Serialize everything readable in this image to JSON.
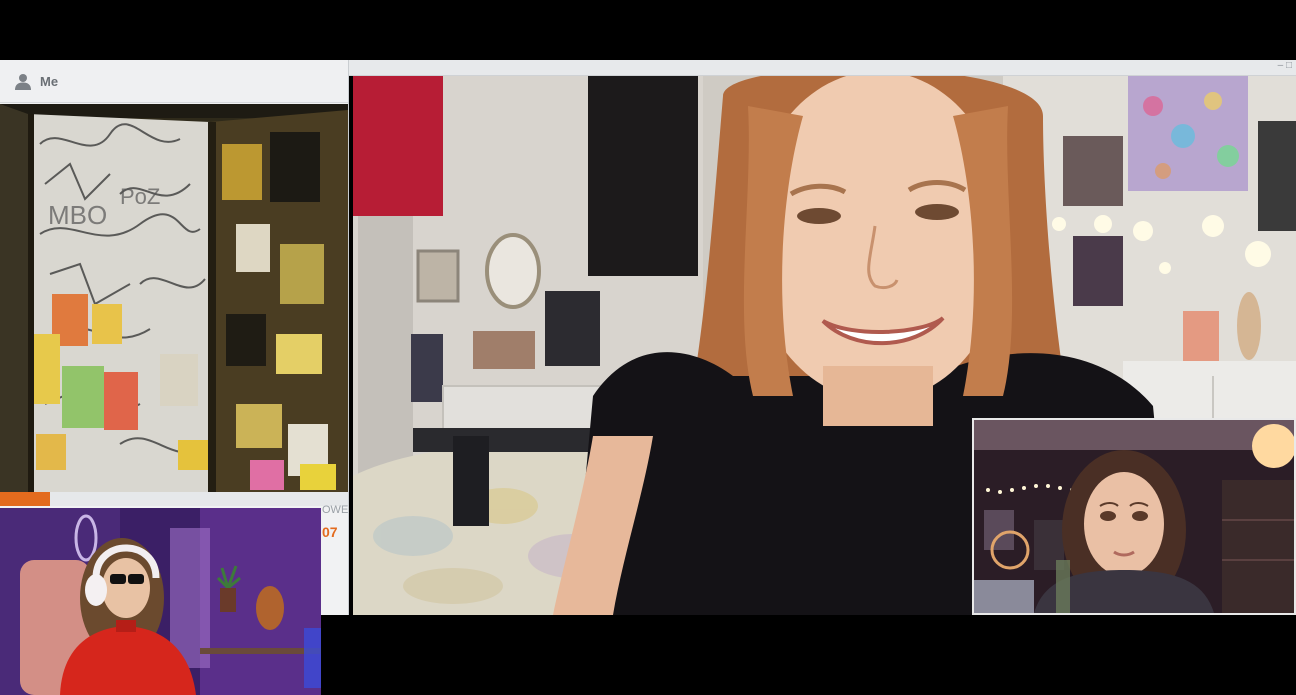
{
  "self_view": {
    "user_icon": "person-icon",
    "label": "Me",
    "progress": 0.145
  },
  "side_panel": {
    "text": "OWEI",
    "number": "07"
  },
  "window": {
    "controls": "– □"
  },
  "colors": {
    "accent": "#e36b1e",
    "panel_bg": "#f1f2f3",
    "label_gray": "#6a6f75"
  }
}
